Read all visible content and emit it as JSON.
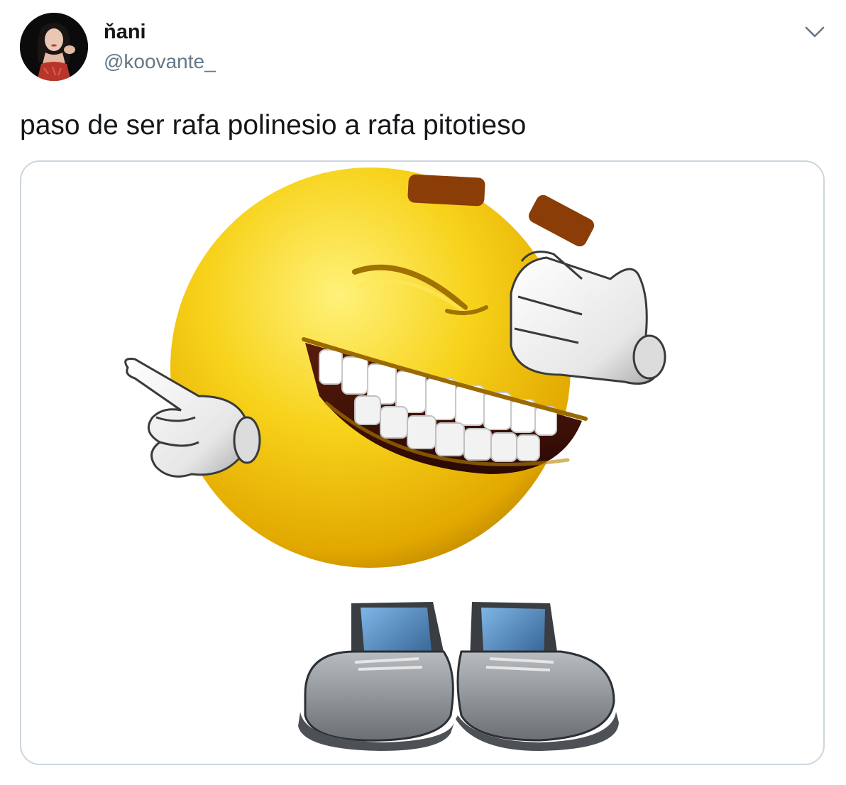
{
  "tweet": {
    "display_name": "ňani",
    "handle": "@koovante_",
    "text": "paso de ser rafa polinesio a rafa pitotieso",
    "menu_icon": "chevron-down-icon",
    "media_description_icon": "laughing-emoji-image"
  },
  "colors": {
    "text_primary": "#14171a",
    "text_secondary": "#657786",
    "border": "#ccd6dd",
    "emoji_yellow": "#f5c400"
  }
}
